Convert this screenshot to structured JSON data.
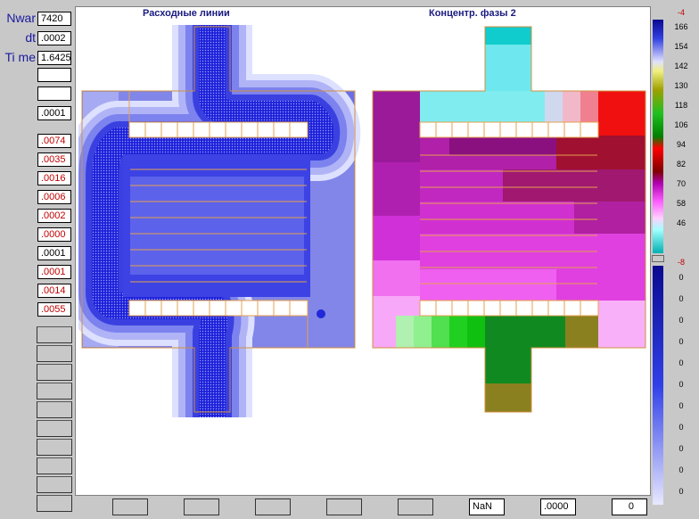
{
  "header": {
    "nwar_label": "Nwar",
    "dt_label": "dt",
    "time_label": "Ti me"
  },
  "params": {
    "nwar": "7420",
    "dt": ".0002",
    "time": "1.6425",
    "empty1": "",
    "empty2": "",
    "p6": ".0001"
  },
  "residuals": [
    ".0074",
    ".0035",
    ".0016",
    ".0006",
    ".0002",
    ".0000",
    ".0001",
    ".0001",
    ".0014",
    ".0055"
  ],
  "residual_colors": [
    "red",
    "red",
    "red",
    "red",
    "red",
    "red",
    "black",
    "red",
    "red",
    "red"
  ],
  "panels": {
    "left_title": "Расходные линии",
    "right_title": "Концентр. фазы 2"
  },
  "scale_top": {
    "max": "-4",
    "ticks": [
      "166",
      "154",
      "142",
      "130",
      "118",
      "106",
      "94",
      "82",
      "70",
      "58",
      "46"
    ],
    "min": "-8"
  },
  "scale_bottom": {
    "ticks": [
      "0",
      "0",
      "0",
      "0",
      "0",
      "0",
      "0",
      "0",
      "0",
      "0",
      "0"
    ]
  },
  "footer": {
    "nan": "NaN",
    "value": ".0000",
    "count": "0"
  },
  "colors": {
    "background": "#c8c8c8",
    "label_blue": "#1a1aa0",
    "residual_red": "#c00000"
  }
}
